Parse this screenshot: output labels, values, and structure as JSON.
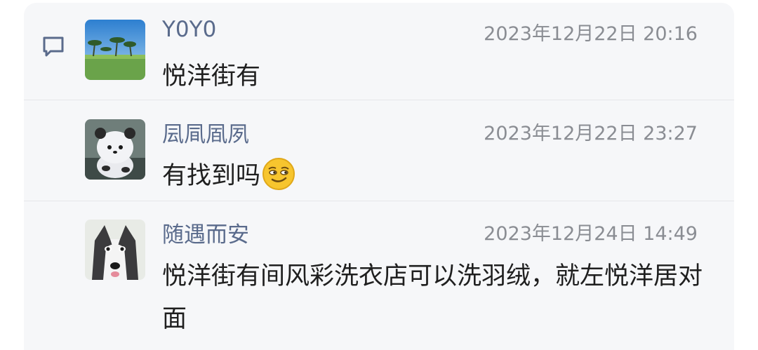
{
  "comments": [
    {
      "author": "Y0Y0",
      "time": "2023年12月22日 20:16",
      "text": "悦洋街有"
    },
    {
      "author": "凨凬凮夙",
      "time": "2023年12月22日 23:27",
      "text": "有找到吗"
    },
    {
      "author": "随遇而安",
      "time": "2023年12月24日 14:49",
      "text": "悦洋街有间风彩洗衣店可以洗羽绒，就左悦洋居对面"
    }
  ],
  "icons": {
    "comment": "comment-bubble-icon",
    "emoji": "smirk-emoji-icon"
  },
  "colors": {
    "author": "#5a6b8c",
    "time": "#8a8d93",
    "text": "#1f1f1f",
    "panel_bg": "#f6f7f9"
  }
}
